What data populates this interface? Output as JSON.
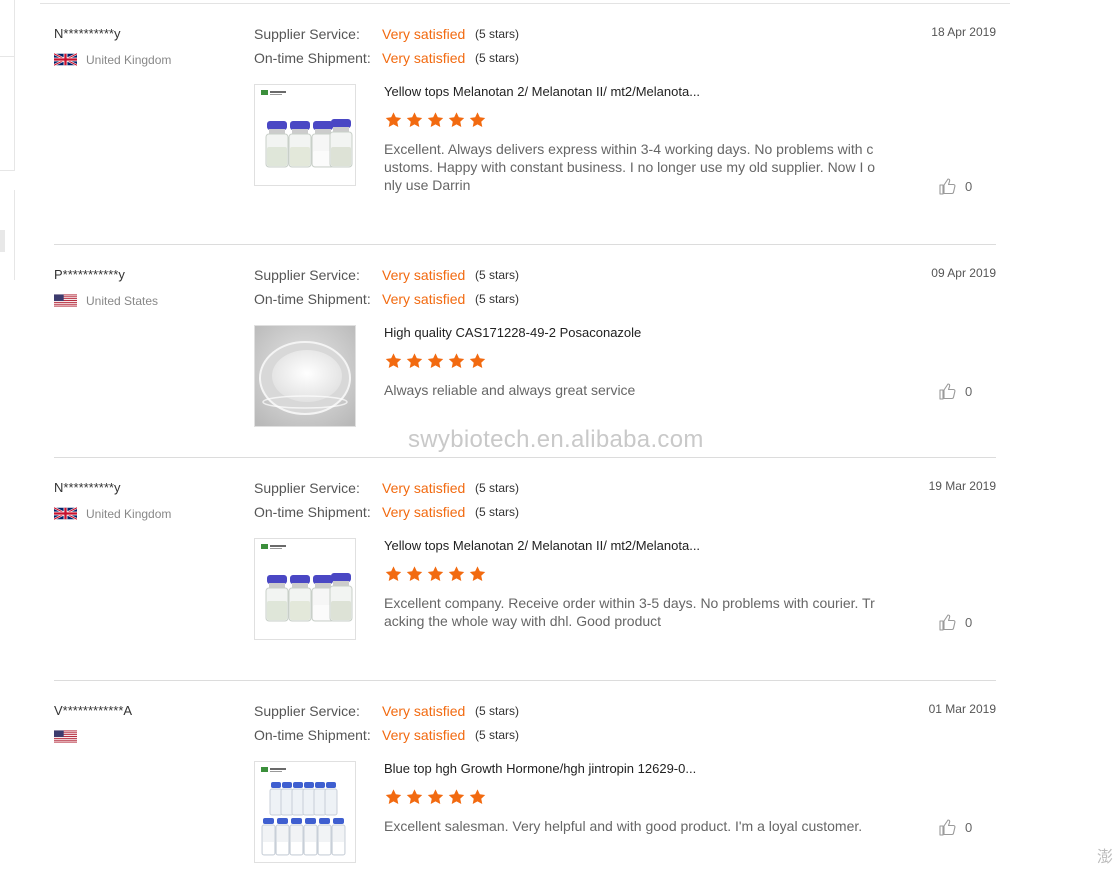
{
  "labels": {
    "supplier_service": "Supplier Service:",
    "on_time_shipment": "On-time Shipment:"
  },
  "watermark": "swybiotech.en.alibaba.com",
  "reviews": [
    {
      "buyer": "N**********y",
      "country": "United Kingdom",
      "flag": "uk",
      "date": "18 Apr 2019",
      "supplier_value": "Very satisfied",
      "supplier_stars": "(5 stars)",
      "shipment_value": "Very satisfied",
      "shipment_stars": "(5 stars)",
      "product": "Yellow tops Melanotan 2/ Melanotan II/ mt2/Melanota...",
      "stars": 5,
      "comment": "Excellent. Always delivers express within 3-4 working days. No problems with customs. Happy with constant business. I no longer use my old supplier. Now I only use Darrin",
      "likes": "0"
    },
    {
      "buyer": "P***********y",
      "country": "United States",
      "flag": "us",
      "date": "09 Apr 2019",
      "supplier_value": "Very satisfied",
      "supplier_stars": "(5 stars)",
      "shipment_value": "Very satisfied",
      "shipment_stars": "(5 stars)",
      "product": "High quality CAS171228-49-2 Posaconazole",
      "stars": 5,
      "comment": "Always reliable and always great service",
      "likes": "0"
    },
    {
      "buyer": "N**********y",
      "country": "United Kingdom",
      "flag": "uk",
      "date": "19 Mar 2019",
      "supplier_value": "Very satisfied",
      "supplier_stars": "(5 stars)",
      "shipment_value": "Very satisfied",
      "shipment_stars": "(5 stars)",
      "product": "Yellow tops Melanotan 2/ Melanotan II/ mt2/Melanota...",
      "stars": 5,
      "comment": "Excellent company. Receive order within 3-5 days. No problems with courier. Tracking the whole way with dhl. Good product",
      "likes": "0"
    },
    {
      "buyer": "V************A",
      "country": "",
      "flag": "us",
      "date": "01 Mar 2019",
      "supplier_value": "Very satisfied",
      "supplier_stars": "(5 stars)",
      "shipment_value": "Very satisfied",
      "shipment_stars": "(5 stars)",
      "product": "Blue top hgh Growth Hormone/hgh jintropin 12629-0...",
      "stars": 5,
      "comment": "Excellent salesman. Very helpful and with good product. I'm a loyal customer.",
      "likes": "0"
    }
  ],
  "colors": {
    "accent": "#f26a10",
    "star": "#f26a10",
    "divider": "#dcdcdc"
  },
  "icons": {
    "like": "thumbs-up-icon",
    "star": "star-icon"
  },
  "corner_text": "澎"
}
